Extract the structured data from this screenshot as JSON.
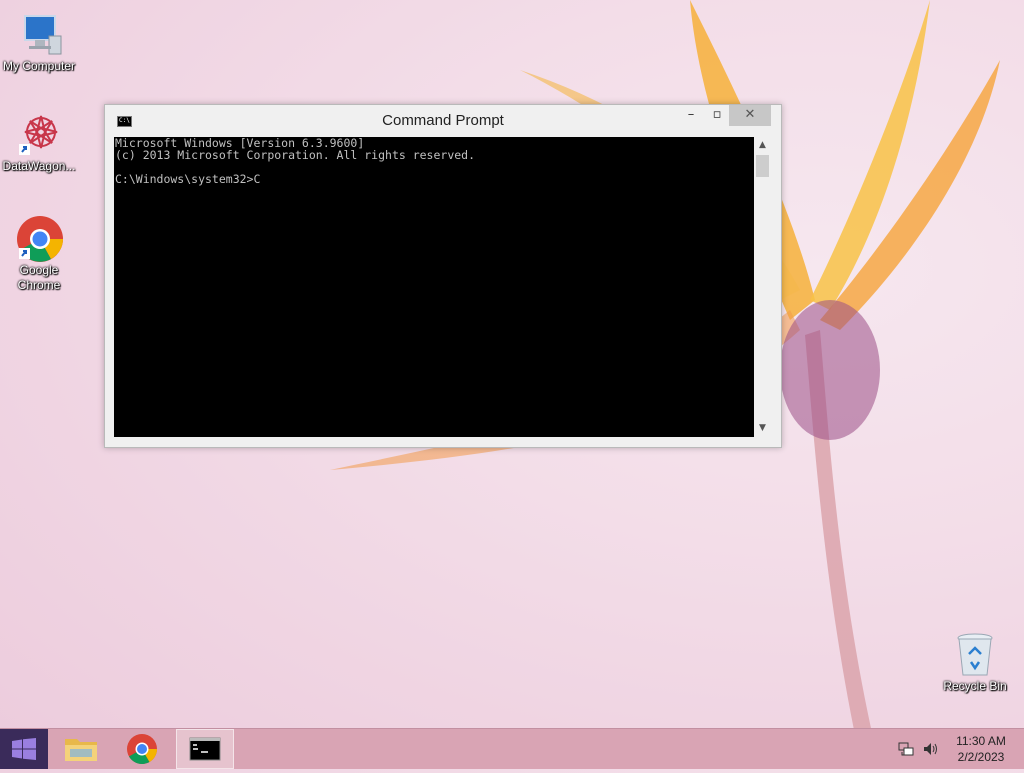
{
  "desktop": {
    "icons": [
      {
        "label": "My Computer"
      },
      {
        "label": "DataWagon..."
      },
      {
        "label": "Google Chrome"
      },
      {
        "label": "Recycle Bin"
      }
    ]
  },
  "window": {
    "title": "Command Prompt",
    "icon_text": "C:\\",
    "minimize": "–",
    "maximize": "▫",
    "close": "✕",
    "console_lines": [
      "Microsoft Windows [Version 6.3.9600]",
      "(c) 2013 Microsoft Corporation. All rights reserved.",
      "",
      "C:\\Windows\\system32>C"
    ]
  },
  "taskbar": {
    "items": [
      "start-button",
      "file-explorer",
      "google-chrome",
      "command-prompt"
    ],
    "clock": {
      "time": "11:30 AM",
      "date": "2/2/2023"
    }
  },
  "colors": {
    "taskbar": "#d9a4b4",
    "start": "#3a2b5a",
    "console_bg": "#000000",
    "console_fg": "#c0c0c0"
  }
}
